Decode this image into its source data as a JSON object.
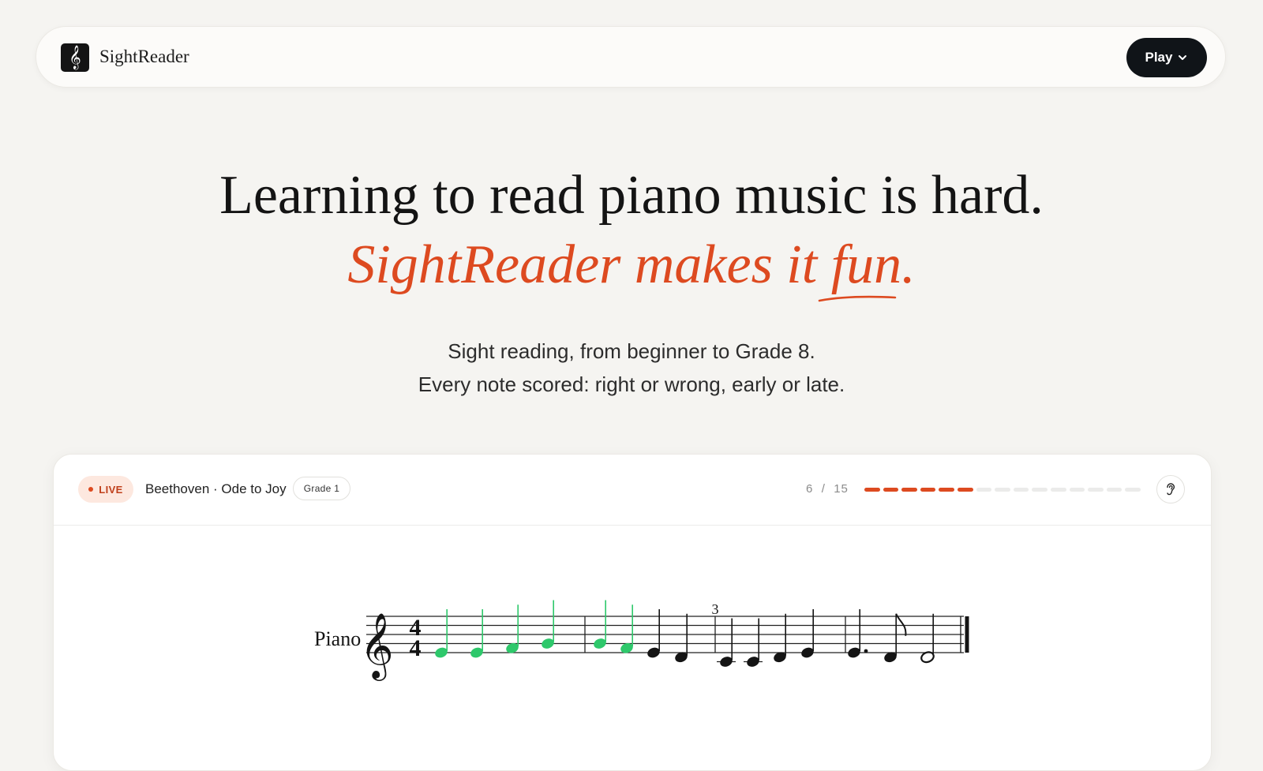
{
  "nav": {
    "brand": "SightReader",
    "logo_glyph": "𝄞",
    "play_label": "Play"
  },
  "hero": {
    "line1": "Learning to read piano music is hard.",
    "line2": "SightReader makes it fun.",
    "sub1": "Sight reading, from beginner to Grade 8.",
    "sub2": "Every note scored: right or wrong, early or late."
  },
  "card": {
    "live_label": "LIVE",
    "piece": "Beethoven · Ode to Joy",
    "grade": "Grade 1",
    "progress_current": "6",
    "progress_sep": "/",
    "progress_total": "15",
    "progress": {
      "done": 6,
      "total": 15
    },
    "colors": {
      "accent": "#dd4a20",
      "correct": "#2ec86b",
      "pending": "#141414"
    }
  },
  "score": {
    "instrument": "Piano",
    "time_sig_top": "4",
    "time_sig_bottom": "4",
    "measure_number": "3",
    "notes": [
      {
        "name": "E4",
        "state": "correct"
      },
      {
        "name": "E4",
        "state": "correct"
      },
      {
        "name": "F4",
        "state": "correct"
      },
      {
        "name": "G4",
        "state": "correct"
      },
      {
        "name": "G4",
        "state": "correct"
      },
      {
        "name": "F4",
        "state": "correct"
      },
      {
        "name": "E4",
        "state": "pending"
      },
      {
        "name": "D4",
        "state": "pending"
      },
      {
        "name": "C4",
        "state": "pending"
      },
      {
        "name": "C4",
        "state": "pending"
      },
      {
        "name": "D4",
        "state": "pending"
      },
      {
        "name": "E4",
        "state": "pending"
      },
      {
        "name": "E4",
        "state": "pending"
      },
      {
        "name": "D4",
        "state": "pending"
      },
      {
        "name": "D4",
        "state": "pending"
      }
    ]
  }
}
